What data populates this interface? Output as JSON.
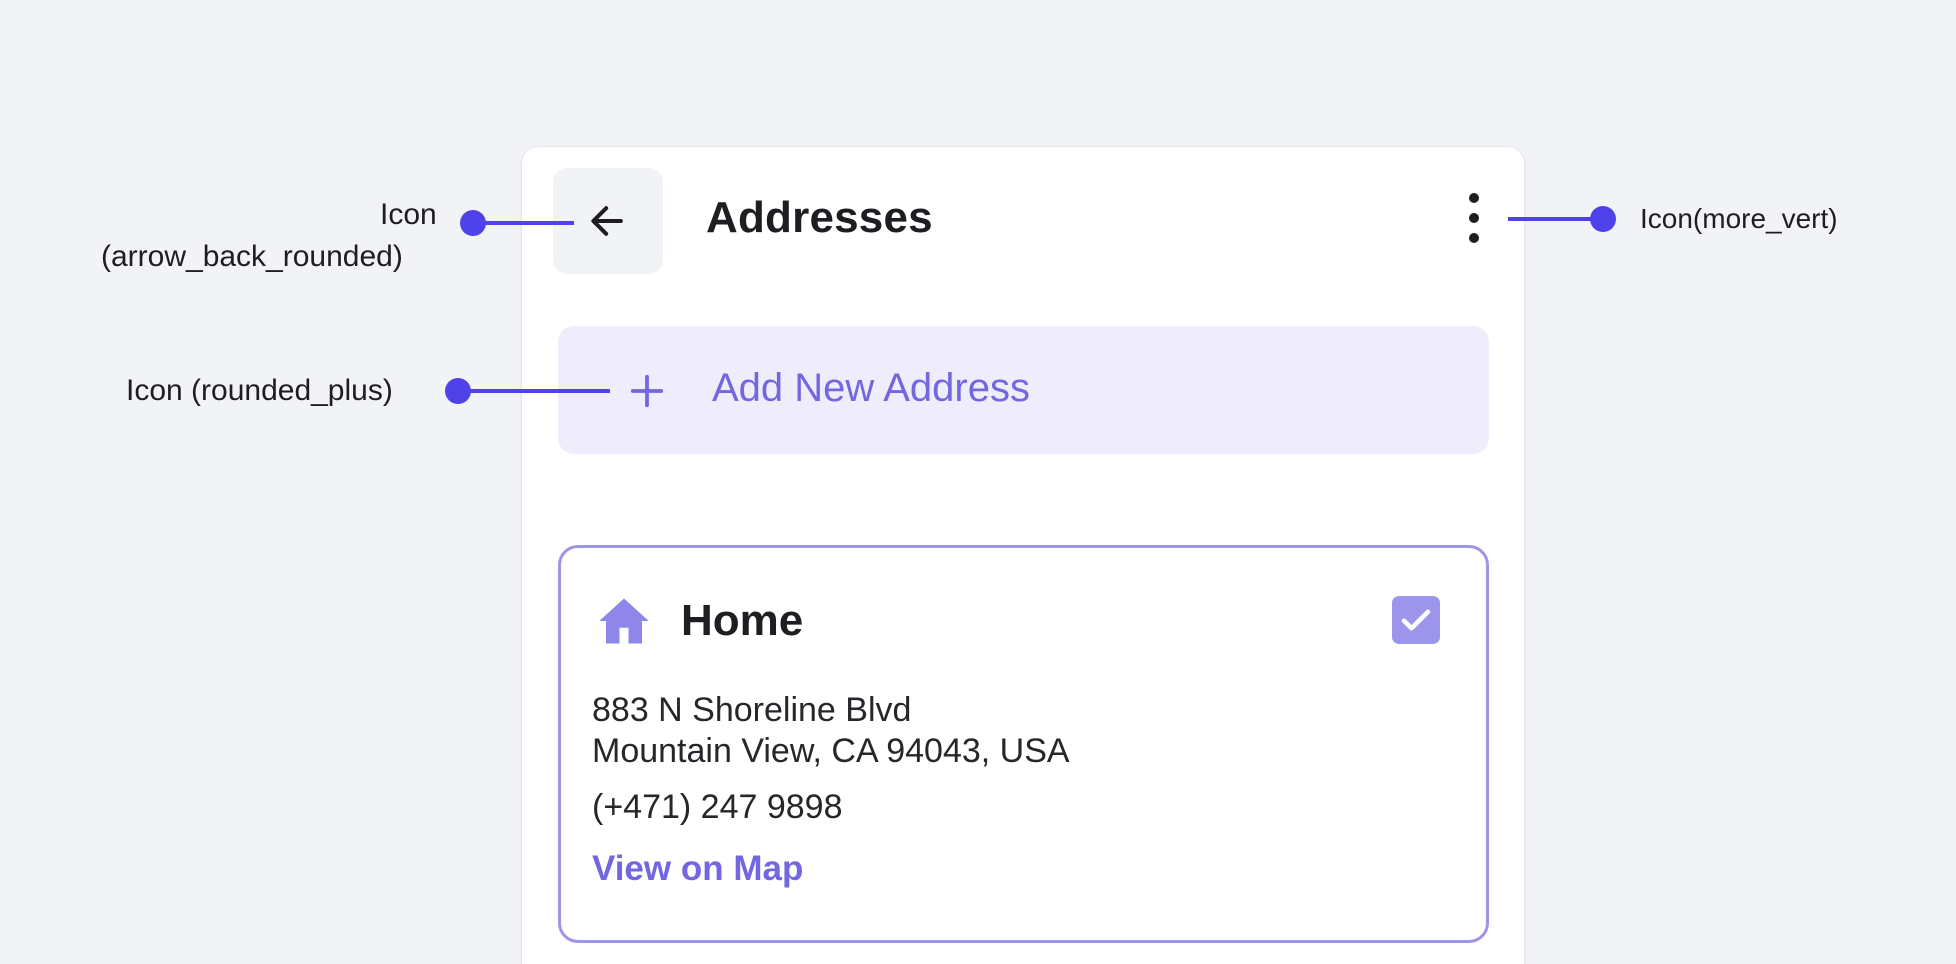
{
  "appbar": {
    "title": "Addresses",
    "back_icon": "arrow-back-icon",
    "more_icon": "more-vert-icon"
  },
  "add_button": {
    "label": "Add New Address",
    "icon": "plus-icon"
  },
  "address_card": {
    "icon": "home-icon",
    "label": "Home",
    "line1": "883 N Shoreline Blvd",
    "line2": "Mountain View, CA 94043, USA",
    "phone": "(+471) 247 9898",
    "map_link": "View on Map",
    "selected": true
  },
  "annotations": {
    "back_line1": "Icon",
    "back_line2": "(arrow_back_rounded)",
    "plus": "Icon (rounded_plus)",
    "more": "Icon(more_vert)"
  },
  "colors": {
    "accent": "#7366e0",
    "accent_light": "#efedfb",
    "card_border": "#9d94ec",
    "annotation": "#4f42e8",
    "background": "#f2f3f7"
  }
}
